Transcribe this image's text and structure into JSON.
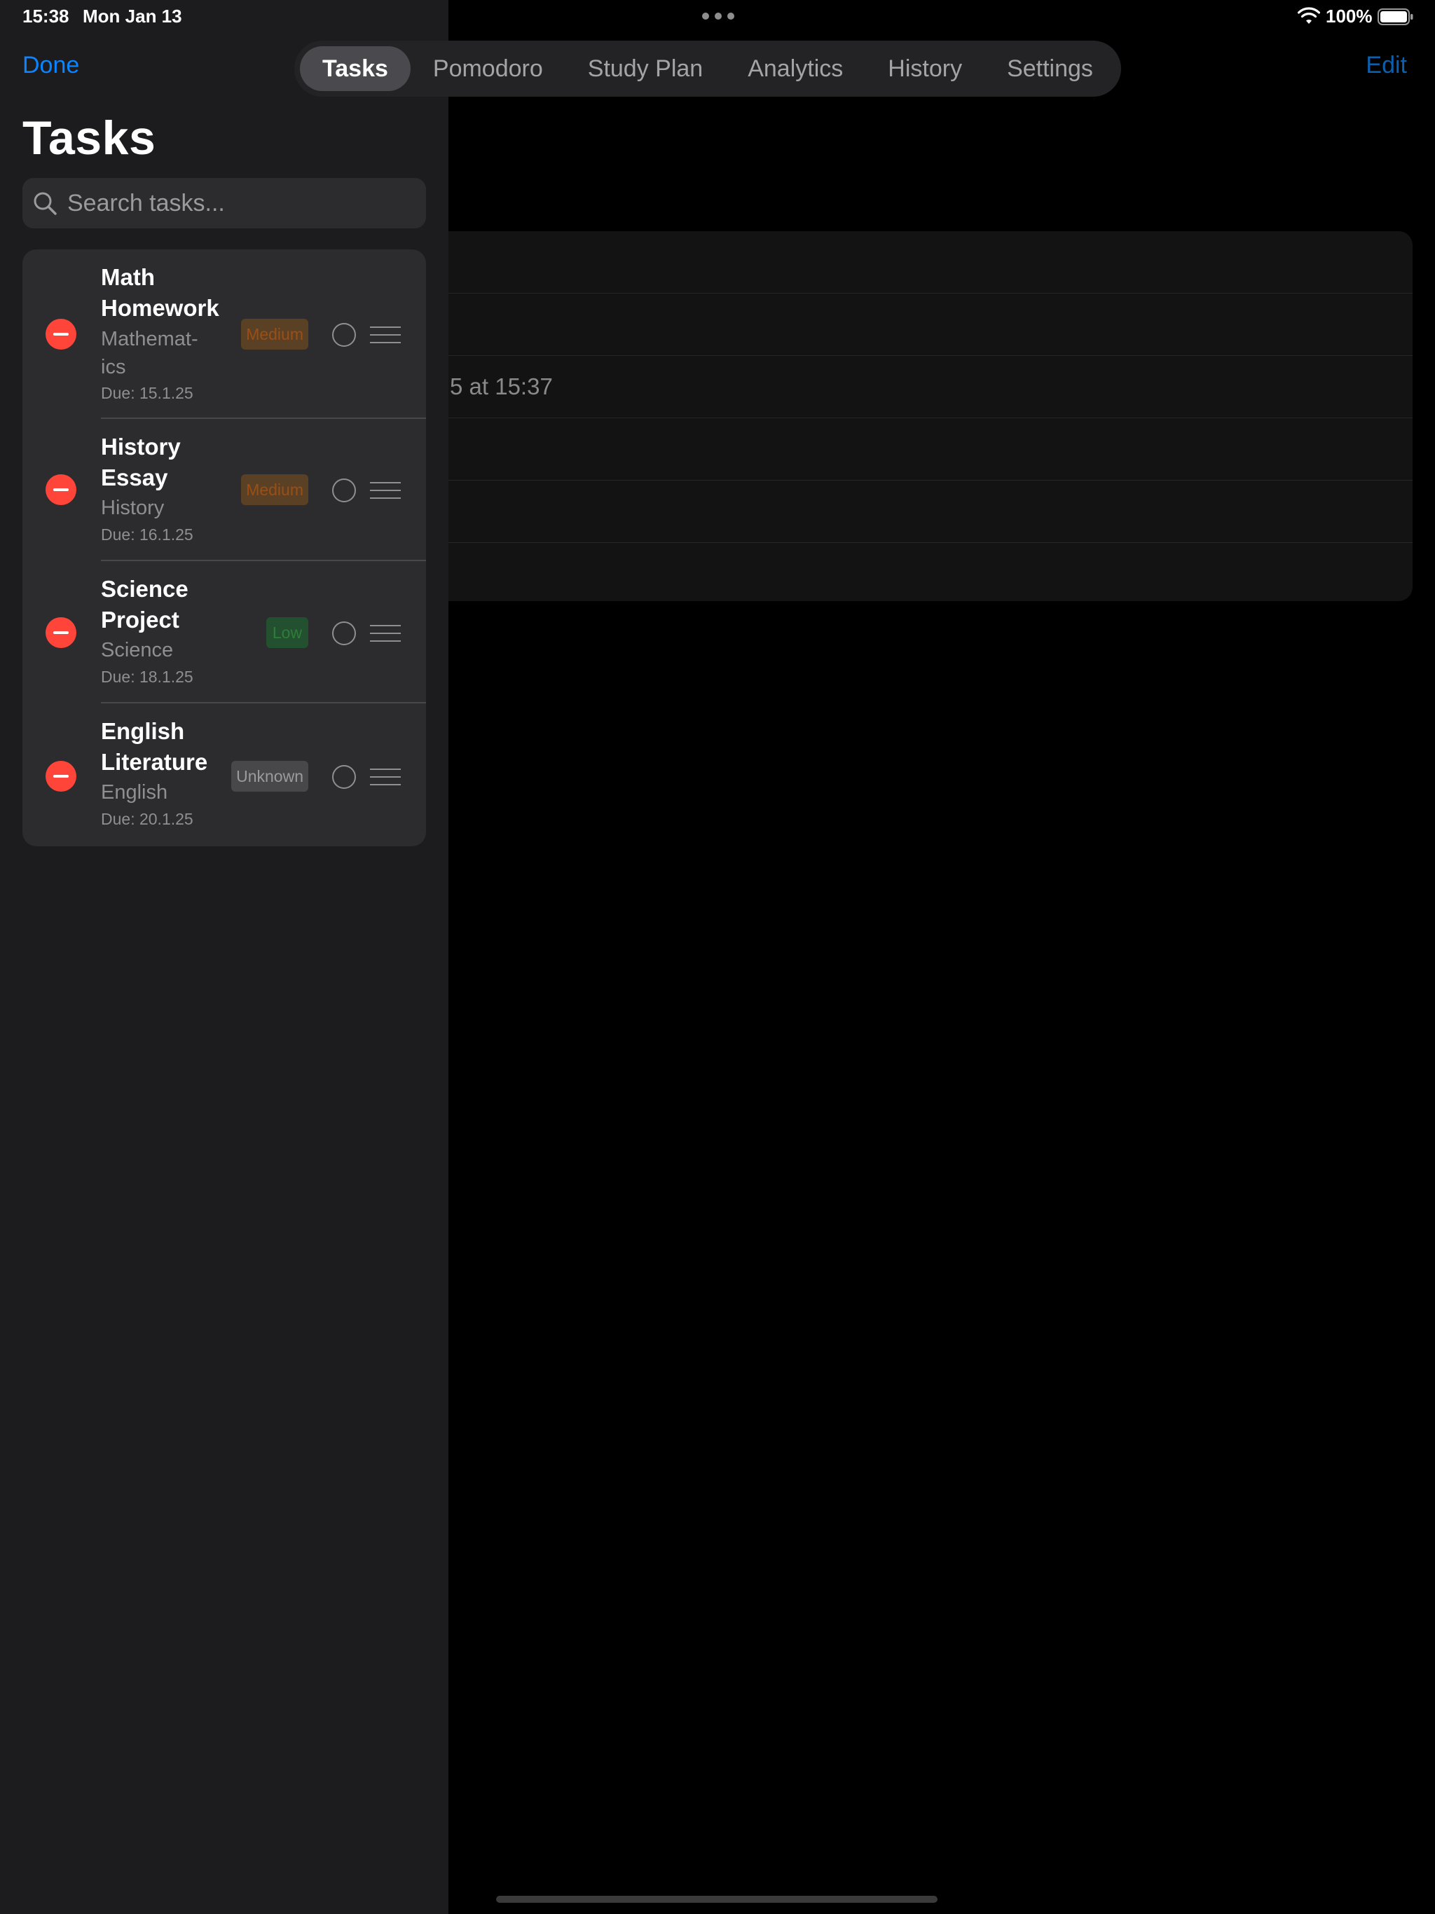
{
  "status_bar": {
    "time": "15:38",
    "date": "Mon Jan 13",
    "battery_percent": "100%",
    "wifi_icon": "wifi-icon",
    "battery_icon": "battery-icon"
  },
  "toolbar": {
    "done_label": "Done",
    "edit_label": "Edit"
  },
  "tabs": [
    {
      "label": "Tasks",
      "active": true
    },
    {
      "label": "Pomodoro",
      "active": false
    },
    {
      "label": "Study Plan",
      "active": false
    },
    {
      "label": "Analytics",
      "active": false
    },
    {
      "label": "History",
      "active": false
    },
    {
      "label": "Settings",
      "active": false
    }
  ],
  "sidebar": {
    "title": "Tasks",
    "search": {
      "placeholder": "Search tasks...",
      "value": ""
    }
  },
  "tasks": [
    {
      "name": "Math Homework",
      "subject": "Mathemat-ics",
      "due": "Due: 15.1.25",
      "priority": "Medium"
    },
    {
      "name": "History Essay",
      "subject": "History",
      "due": "Due: 16.1.25",
      "priority": "Medium"
    },
    {
      "name": "Science Project",
      "subject": "Science",
      "due": "Due: 18.1.25",
      "priority": "Low"
    },
    {
      "name": "English Literature",
      "subject": "English",
      "due": "Due: 20.1.25",
      "priority": "Unknown"
    }
  ],
  "detail": {
    "rows": [
      "",
      "",
      "5 at 15:37",
      "",
      "",
      ""
    ]
  },
  "colors": {
    "accent": "#0a84ff",
    "delete": "#ff453a",
    "medium_badge_bg": "#5a4025",
    "medium_badge_text": "#9a4f16",
    "low_badge_bg": "#23502e",
    "low_badge_text": "#2e7d3a",
    "unknown_badge_bg": "#48484a"
  }
}
